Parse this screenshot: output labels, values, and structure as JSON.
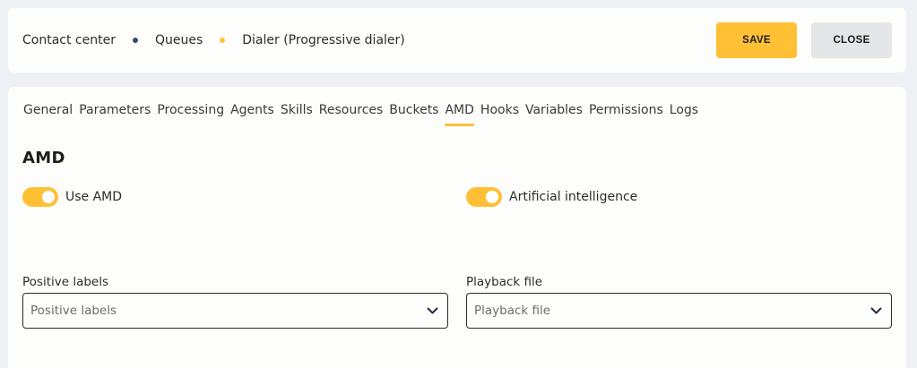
{
  "breadcrumb": {
    "items": [
      "Contact center",
      "Queues",
      "Dialer (Progressive dialer)"
    ]
  },
  "actions": {
    "save_label": "SAVE",
    "close_label": "CLOSE"
  },
  "tabs": [
    {
      "label": "General"
    },
    {
      "label": "Parameters"
    },
    {
      "label": "Processing"
    },
    {
      "label": "Agents"
    },
    {
      "label": "Skills"
    },
    {
      "label": "Resources"
    },
    {
      "label": "Buckets"
    },
    {
      "label": "AMD",
      "active": true
    },
    {
      "label": "Hooks"
    },
    {
      "label": "Variables"
    },
    {
      "label": "Permissions"
    },
    {
      "label": "Logs"
    }
  ],
  "section": {
    "title": "AMD"
  },
  "toggles": {
    "use_amd": {
      "label": "Use AMD",
      "on": true
    },
    "ai": {
      "label": "Artificial intelligence",
      "on": true
    }
  },
  "fields": {
    "positive_labels": {
      "label": "Positive labels",
      "placeholder": "Positive labels"
    },
    "playback_file": {
      "label": "Playback file",
      "placeholder": "Playback file"
    }
  },
  "colors": {
    "accent": "#ffc036",
    "breadcrumb_dot_dark": "#3a4a63",
    "page_bg": "#eff0f4",
    "card_bg": "#fdfdfc"
  }
}
